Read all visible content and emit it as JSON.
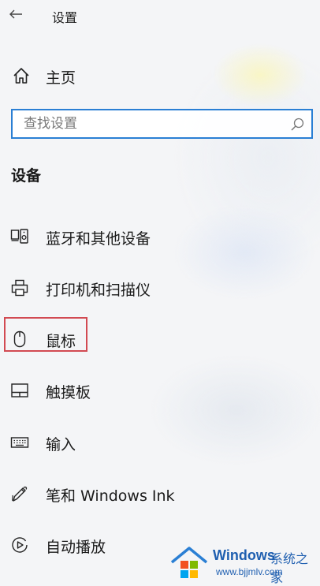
{
  "header": {
    "title": "设置"
  },
  "home": {
    "label": "主页"
  },
  "search": {
    "placeholder": "查找设置"
  },
  "section": {
    "title": "设备"
  },
  "nav": {
    "items": [
      {
        "label": "蓝牙和其他设备",
        "icon": "bluetooth-devices-icon"
      },
      {
        "label": "打印机和扫描仪",
        "icon": "printer-icon"
      },
      {
        "label": "鼠标",
        "icon": "mouse-icon",
        "highlighted": true
      },
      {
        "label": "触摸板",
        "icon": "touchpad-icon"
      },
      {
        "label": "输入",
        "icon": "keyboard-icon"
      },
      {
        "label": "笔和 Windows Ink",
        "icon": "pen-icon"
      },
      {
        "label": "自动播放",
        "icon": "autoplay-icon"
      }
    ]
  },
  "watermark": {
    "brand": "Windows",
    "brand_cn": "系统之家",
    "url": "www.bjjmlv.com"
  },
  "colors": {
    "accent": "#2a7fd4",
    "highlight": "#d24a52",
    "text": "#1a1a1a"
  }
}
